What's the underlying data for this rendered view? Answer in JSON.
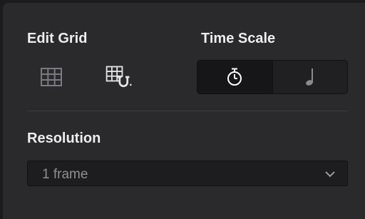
{
  "edit_grid": {
    "heading": "Edit Grid",
    "buttons": [
      {
        "icon": "grid-icon"
      },
      {
        "icon": "grid-snap-icon"
      }
    ]
  },
  "time_scale": {
    "heading": "Time Scale",
    "options": [
      {
        "icon": "stopwatch-icon",
        "selected": true
      },
      {
        "icon": "quarter-note-icon",
        "selected": false
      }
    ]
  },
  "resolution": {
    "heading": "Resolution",
    "value": "1 frame"
  },
  "colors": {
    "panel_bg": "#2a2a2d",
    "text": "#ededf0",
    "muted_text": "#8e8e93"
  }
}
